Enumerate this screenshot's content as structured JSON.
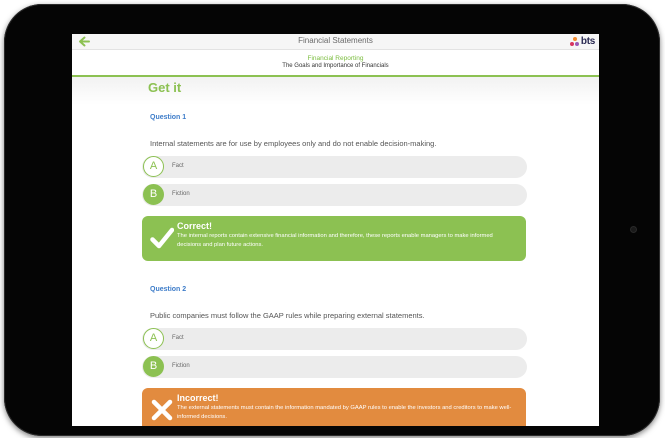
{
  "colors": {
    "accent_green": "#8cc152",
    "question_blue": "#3d7cc9",
    "incorrect_orange": "#e28b3f",
    "logo_navy": "#2c2c54"
  },
  "topbar": {
    "back_icon": "back-arrow-icon",
    "title": "Financial Statements",
    "logo_text": "bts"
  },
  "subheader": {
    "module": "Financial Reporting",
    "topic": "The Goals and Importance of Financials"
  },
  "section_title": "Get it",
  "questions": [
    {
      "label": "Question 1",
      "text": "Internal statements are for use by employees only and do not enable decision-making.",
      "options": [
        {
          "letter": "A",
          "label": "Fact"
        },
        {
          "letter": "B",
          "label": "Fiction"
        }
      ],
      "selected": "B",
      "feedback": {
        "status": "correct",
        "icon": "checkmark-icon",
        "title": "Correct!",
        "text": "The internal reports contain extensive financial information and therefore, these reports enable managers to make informed decisions and plan future actions."
      }
    },
    {
      "label": "Question 2",
      "text": "Public companies must follow the GAAP rules while preparing external statements.",
      "options": [
        {
          "letter": "A",
          "label": "Fact"
        },
        {
          "letter": "B",
          "label": "Fiction"
        }
      ],
      "selected": "B",
      "feedback": {
        "status": "incorrect",
        "icon": "cross-icon",
        "title": "Incorrect!",
        "text": "The external statements must contain the information mandated by GAAP rules to enable the investors and creditors to make well-informed decisions."
      }
    }
  ]
}
